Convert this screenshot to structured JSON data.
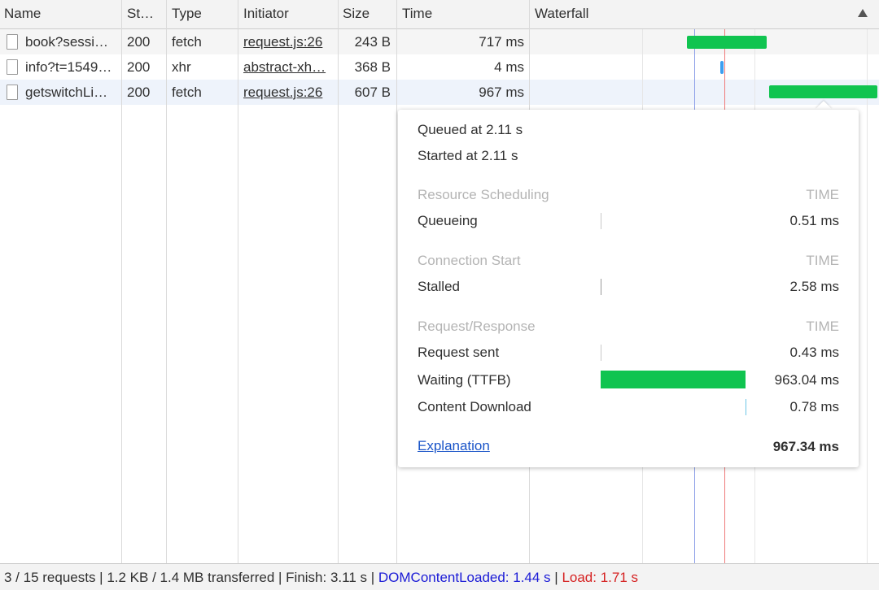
{
  "columns": {
    "name": "Name",
    "status": "St…",
    "type": "Type",
    "initiator": "Initiator",
    "size": "Size",
    "time": "Time",
    "waterfall": "Waterfall"
  },
  "rows": [
    {
      "name": "book?sessi…",
      "status": "200",
      "type": "fetch",
      "initiator": "request.js:26",
      "size": "243 B",
      "time": "717 ms"
    },
    {
      "name": "info?t=1549…",
      "status": "200",
      "type": "xhr",
      "initiator": "abstract-xh…",
      "size": "368 B",
      "time": "4 ms"
    },
    {
      "name": "getswitchLi…",
      "status": "200",
      "type": "fetch",
      "initiator": "request.js:26",
      "size": "607 B",
      "time": "967 ms"
    }
  ],
  "timing": {
    "queued_at": "Queued at 2.11 s",
    "started_at": "Started at 2.11 s",
    "time_label": "TIME",
    "sections": [
      {
        "title": "Resource Scheduling",
        "items": [
          {
            "label": "Queueing",
            "value": "0.51 ms"
          }
        ]
      },
      {
        "title": "Connection Start",
        "items": [
          {
            "label": "Stalled",
            "value": "2.58 ms"
          }
        ]
      },
      {
        "title": "Request/Response",
        "items": [
          {
            "label": "Request sent",
            "value": "0.43 ms"
          },
          {
            "label": "Waiting (TTFB)",
            "value": "963.04 ms"
          },
          {
            "label": "Content Download",
            "value": "0.78 ms"
          }
        ]
      }
    ],
    "explanation": "Explanation",
    "total": "967.34 ms"
  },
  "status_bar": {
    "summary": "3 / 15 requests | 1.2 KB / 1.4 MB transferred | Finish: 3.11 s | ",
    "dom_label": "DOMContentLoaded: 1.44 s",
    "sep": " | ",
    "load_label": "Load: 1.71 s"
  },
  "colors": {
    "waterfall_bar": "#10c450",
    "dom_line": "#8c9fe8",
    "load_line": "#ef7a7a",
    "link": "#1a54c8"
  }
}
